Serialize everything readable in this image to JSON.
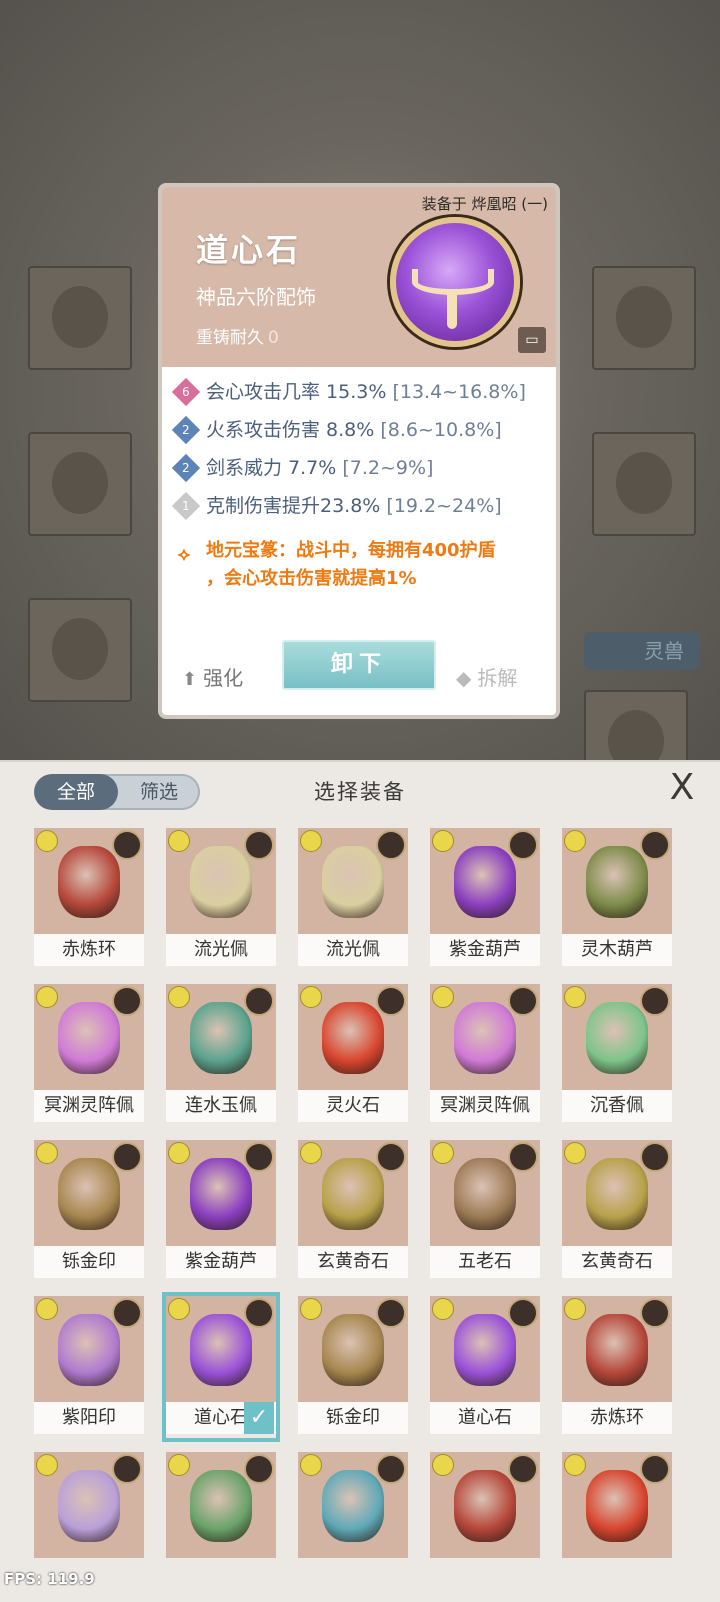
{
  "card": {
    "equipped_on": "装备于 烨凰昭 (一)",
    "name": "道心石",
    "grade": "神品六阶配饰",
    "recast_label": "重铸耐久",
    "recast_value": "0",
    "stats": [
      {
        "badge": "6",
        "text": "会心攻击几率 15.3%",
        "range": "[13.4~16.8%]"
      },
      {
        "badge": "2",
        "text": "火系攻击伤害 8.8%",
        "range": "[8.6~10.8%]"
      },
      {
        "badge": "2",
        "text": "剑系威力 7.7%",
        "range": "[7.2~9%]"
      },
      {
        "badge": "1",
        "text": "克制伤害提升23.8%",
        "range": "[19.2~24%]"
      }
    ],
    "special_line1": "地元宝篆：战斗中，每拥有400护盾",
    "special_line2": "，会心攻击伤害就提高1%",
    "enhance": "强化",
    "unequip": "卸下",
    "dismantle": "拆解"
  },
  "background": {
    "beast_label": "灵兽"
  },
  "panel": {
    "tab_all": "全部",
    "tab_filter": "筛选",
    "title": "选择装备",
    "close": "X",
    "items": [
      {
        "name": "赤炼环",
        "color": "#b5473a"
      },
      {
        "name": "流光佩",
        "color": "#d9cfa0"
      },
      {
        "name": "流光佩",
        "color": "#d9cfa0"
      },
      {
        "name": "紫金葫芦",
        "color": "#8b3fc0"
      },
      {
        "name": "灵木葫芦",
        "color": "#7d8c4a"
      },
      {
        "name": "冥渊灵阵佩",
        "color": "#d07ad6"
      },
      {
        "name": "连水玉佩",
        "color": "#5aa38e"
      },
      {
        "name": "灵火石",
        "color": "#d8452e"
      },
      {
        "name": "冥渊灵阵佩",
        "color": "#d07ad6"
      },
      {
        "name": "沉香佩",
        "color": "#7dc48a"
      },
      {
        "name": "铄金印",
        "color": "#a7874e"
      },
      {
        "name": "紫金葫芦",
        "color": "#8b3fc0"
      },
      {
        "name": "玄黄奇石",
        "color": "#b8a14a"
      },
      {
        "name": "五老石",
        "color": "#9c7a55"
      },
      {
        "name": "玄黄奇石",
        "color": "#b8a14a"
      },
      {
        "name": "紫阳印",
        "color": "#b07ad0"
      },
      {
        "name": "道心石",
        "color": "#9b52d8",
        "selected": true
      },
      {
        "name": "铄金印",
        "color": "#a7874e"
      },
      {
        "name": "道心石",
        "color": "#9b52d8"
      },
      {
        "name": "赤炼环",
        "color": "#b5473a"
      },
      {
        "name": "",
        "color": "#b9a0d8"
      },
      {
        "name": "",
        "color": "#6aa36a"
      },
      {
        "name": "",
        "color": "#5fa9b8"
      },
      {
        "name": "",
        "color": "#b5473a"
      },
      {
        "name": "",
        "color": "#d8452e"
      }
    ]
  },
  "fps": "FPS: 119.9"
}
